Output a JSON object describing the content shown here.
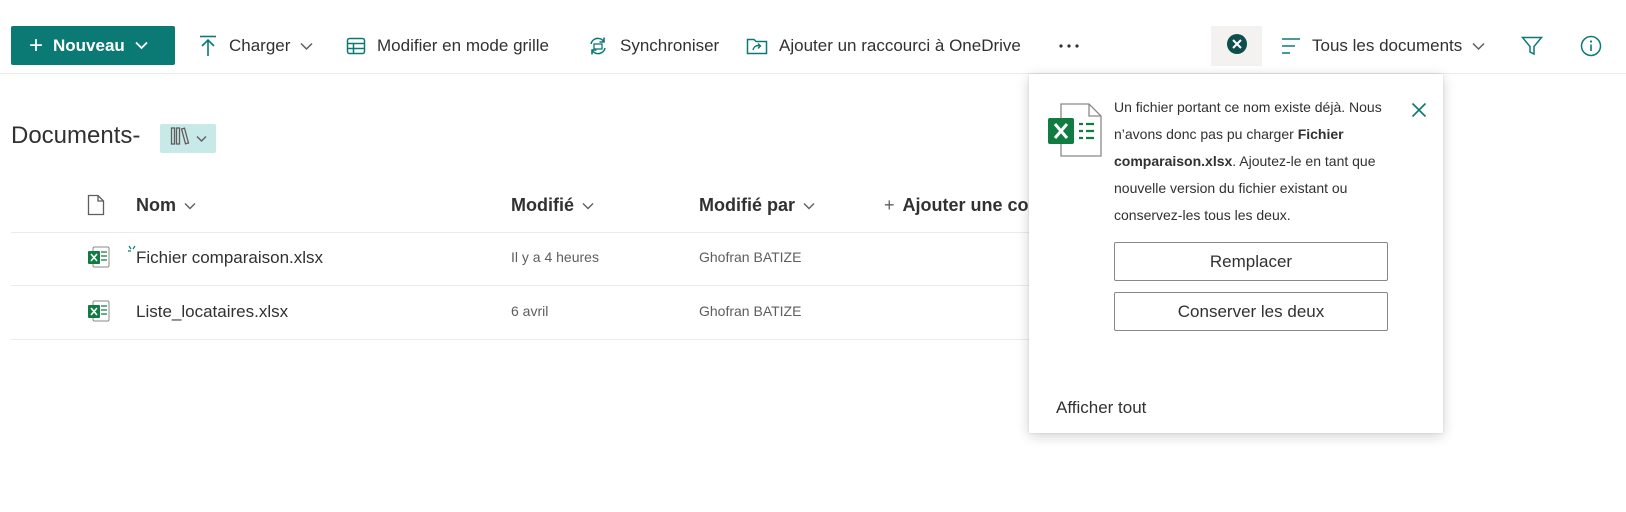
{
  "toolbar": {
    "new_label": "Nouveau",
    "upload_label": "Charger",
    "grid_edit_label": "Modifier en mode grille",
    "sync_label": "Synchroniser",
    "shortcut_label": "Ajouter un raccourci à OneDrive",
    "view_label": "Tous les documents"
  },
  "library": {
    "title": "Documents-"
  },
  "columns": {
    "name": "Nom",
    "modified": "Modifié",
    "modified_by": "Modifié par",
    "add_column": "Ajouter une colonne"
  },
  "files": [
    {
      "name": "Fichier comparaison.xlsx",
      "modified": "Il y a 4 heures",
      "modified_by": "Ghofran BATIZE"
    },
    {
      "name": "Liste_locataires.xlsx",
      "modified": "6 avril",
      "modified_by": "Ghofran BATIZE"
    }
  ],
  "notification": {
    "message_part1": "Un fichier portant ce nom existe déjà. Nous n’avons donc pas pu charger",
    "file_name": "Fichier comparaison.xlsx",
    "message_part2": ". Ajoutez-le en tant que nouvelle version du fichier existant ou conservez-les tous les deux.",
    "replace_label": "Remplacer",
    "keep_both_label": "Conserver les deux",
    "show_all_label": "Afficher tout"
  },
  "icons": {
    "new": "plus-icon",
    "upload": "upload-arrow-icon",
    "grid": "grid-icon",
    "sync": "sync-icon",
    "shortcut": "onedrive-shortcut-icon",
    "more": "more-ellipsis-icon",
    "status": "error-circle-icon",
    "view": "list-view-icon",
    "filter": "filter-icon",
    "info": "info-icon",
    "file": "excel-file-icon",
    "close": "close-icon"
  },
  "colors": {
    "accent": "#0b7a75",
    "view_pill": "#c7e9e8",
    "excel_green": "#107c41",
    "status_bg": "#f3f2f1"
  }
}
